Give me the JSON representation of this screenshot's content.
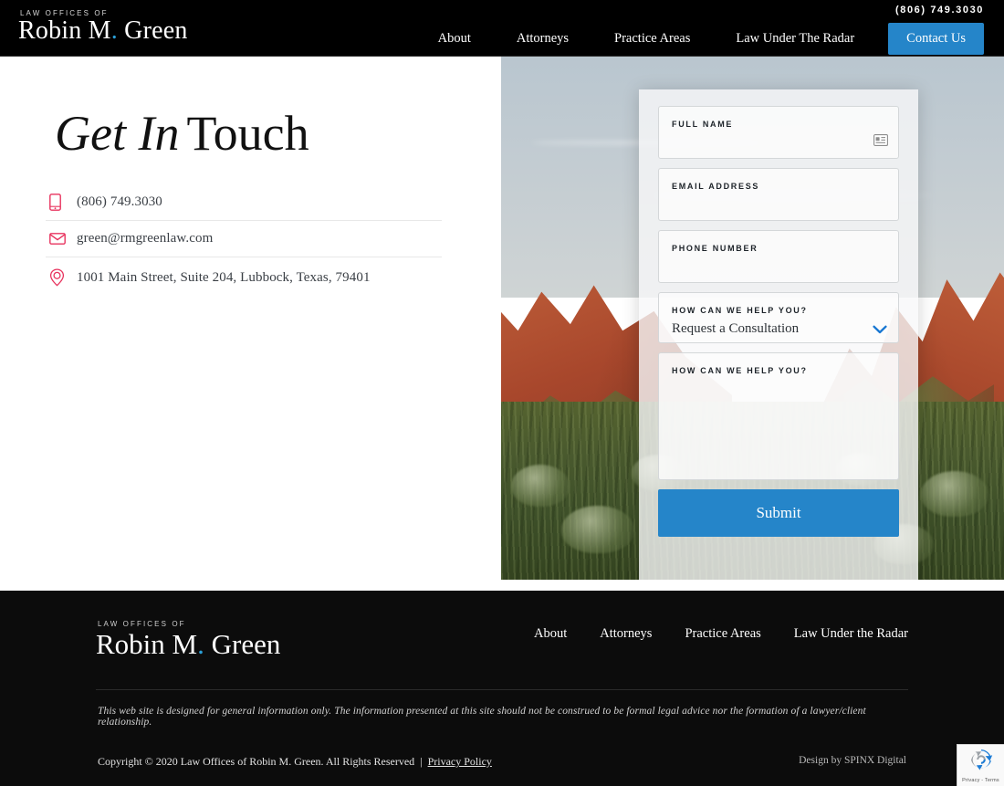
{
  "header": {
    "logo": {
      "kicker": "LAW OFFICES OF",
      "name_a": "Robin M",
      "dot": ".",
      "name_b": " Green"
    },
    "phone": "(806) 749.3030",
    "nav": [
      {
        "label": "About"
      },
      {
        "label": "Attorneys"
      },
      {
        "label": "Practice Areas"
      },
      {
        "label": "Law Under The Radar"
      }
    ],
    "cta_label": "Contact Us"
  },
  "main": {
    "heading_italic": "Get In",
    "heading_regular": "Touch",
    "contacts": [
      {
        "icon": "phone-icon",
        "value": "(806) 749.3030"
      },
      {
        "icon": "envelope-icon",
        "value": "green@rmgreenlaw.com"
      },
      {
        "icon": "location-pin-icon",
        "value": "1001 Main Street, Suite 204, Lubbock, Texas, 79401"
      }
    ]
  },
  "form": {
    "fields": [
      {
        "label": "FULL NAME",
        "value": "",
        "placeholder": ""
      },
      {
        "label": "EMAIL ADDRESS",
        "value": "",
        "placeholder": ""
      },
      {
        "label": "PHONE NUMBER",
        "value": "",
        "placeholder": ""
      }
    ],
    "select": {
      "label": "HOW CAN WE HELP YOU?",
      "selected": "Request a Consultation"
    },
    "message": {
      "label": "HOW CAN WE HELP YOU?",
      "value": ""
    },
    "submit_label": "Submit"
  },
  "footer": {
    "logo": {
      "kicker": "LAW OFFICES OF",
      "name_a": "Robin M",
      "dot": ".",
      "name_b": " Green"
    },
    "nav": [
      {
        "label": "About"
      },
      {
        "label": "Attorneys"
      },
      {
        "label": "Practice Areas"
      },
      {
        "label": "Law Under the Radar"
      }
    ],
    "disclaimer": "This web site is designed for general information only. The information presented at this site should not be construed to be formal legal advice nor the formation of a lawyer/client relationship.",
    "copyright": "Copyright © 2020 Law Offices of Robin M. Green. All Rights Reserved",
    "separator": "|",
    "privacy_link": "Privacy Policy",
    "design_credit": "Design by SPINX Digital"
  },
  "recaptcha": {
    "text": "Privacy - Terms"
  },
  "colors": {
    "accent_blue": "#2585c9",
    "logo_dot_blue": "#2a9fd8",
    "icon_pink": "#e8335e",
    "header_bg": "#000000",
    "footer_bg": "#0c0c0c"
  }
}
